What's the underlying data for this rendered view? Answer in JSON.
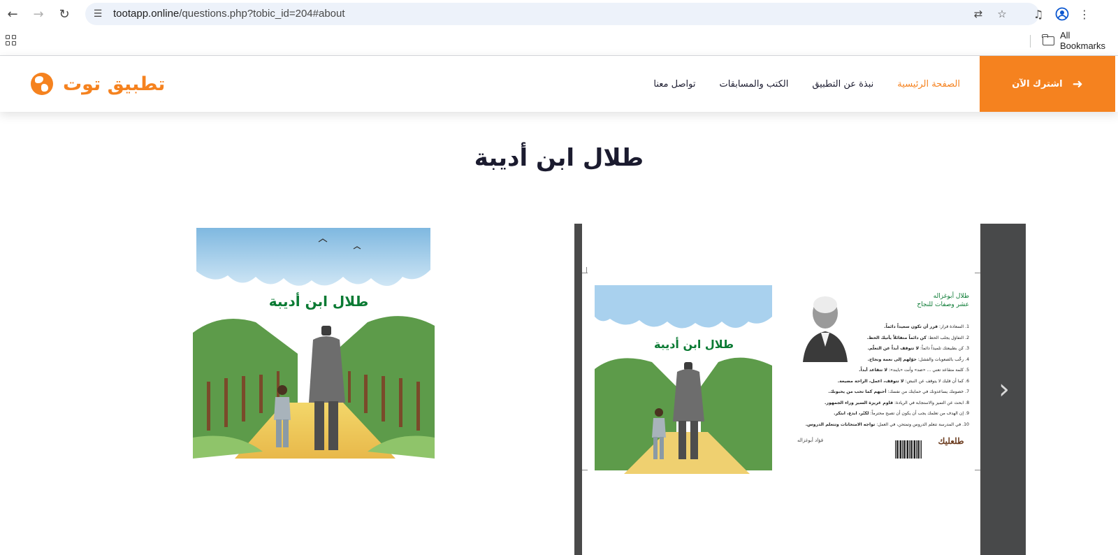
{
  "browser": {
    "url_host": "tootapp.online",
    "url_path": "/questions.php?tobic_id=204#about",
    "bookmarks_label": "All Bookmarks"
  },
  "header": {
    "subscribe_label": "اشترك الآن",
    "menu": [
      {
        "label": "الصفحة الرئيسية",
        "active": true
      },
      {
        "label": "نبذة عن التطبيق",
        "active": false
      },
      {
        "label": "الكتب والمسابقات",
        "active": false
      },
      {
        "label": "تواصل معنا",
        "active": false
      }
    ],
    "brand_name": "تطبيق توت"
  },
  "page": {
    "title": "طلال ابن أديبة",
    "cover_title": "طلال ابن أديبة"
  },
  "back_cover": {
    "title_line1": "طلال أبوغزاله",
    "title_line2": "عشر وصفات للنجاح",
    "tips": [
      {
        "text": "1. السعادة قرار: ",
        "bold": "قرر أن تكون سعيداً دائماً."
      },
      {
        "text": "2. التفاؤل يجلب الحظ: ",
        "bold": "كن دائماً متفائلاً يأتيك الحظ."
      },
      {
        "text": "3. كن بطبيعتك تلميذاً دائماً: ",
        "bold": "لا تتوقف أبداً عن التعلّم."
      },
      {
        "text": "4. رحِّب بالصعوبات والفشل: ",
        "bold": "حوّلهم إلى نعمة ونجاح."
      },
      {
        "text": "5. كلمة متقاعد تعني ... «ضد» وأنت «بايند»: ",
        "bold": "لا تتقاعد أبداً."
      },
      {
        "text": "6. كما أن قلبك لا يتوقف عن النبض: ",
        "bold": "لا تتوقف، اعمل، الراحة مضيعة."
      },
      {
        "text": "7. خصومك يساعدونك في حمايتك من نفسك: ",
        "bold": "أحبهم كما تحب من يحبونك."
      },
      {
        "text": "8. ابحث عن التميز والاستجابة في الريادة: ",
        "bold": "قاوم غريزة السير وراء الجمهور."
      },
      {
        "text": "9. إن الهدف من تعلمك يجب أن يكون أن تصبح محترماً: ",
        "bold": "لكبّر، ابدع، ابتكر."
      },
      {
        "text": "10. في المدرسة تتعلم الدروس وتمتحن، في العمل: ",
        "bold": "تواجه الامتحانات وتتعلم الدروس."
      }
    ],
    "author": "فؤاد أبوغزاله",
    "logo_text": "طلعليك"
  },
  "icons": {
    "back": "arrow-left-icon",
    "forward": "arrow-right-icon",
    "reload": "reload-icon",
    "next": "chevron-right-icon"
  },
  "colors": {
    "accent": "#f5821f",
    "heading": "#1b1b2f",
    "green_title": "#0a7a33",
    "carousel_bg": "#4a4a4a"
  }
}
